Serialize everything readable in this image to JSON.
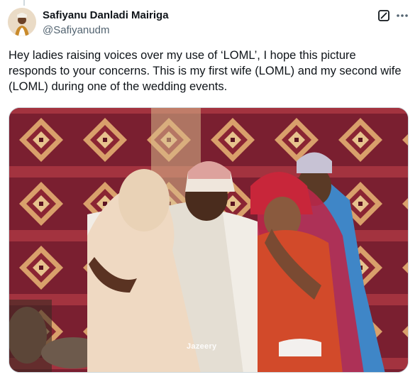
{
  "author": {
    "name": "Safiyanu Danladi Mairiga",
    "handle": "@Safiyanudm",
    "avatar_icon": "profile-photo"
  },
  "actions": {
    "grok_icon": "grok-icon",
    "more_icon": "more-icon"
  },
  "tweet": {
    "text": "Hey ladies raising voices over my use of ‘LOML’, I hope this picture responds to your concerns. This is my first wife (LOML) and my second wife (LOML) during one of the wedding events."
  },
  "media": {
    "watermark": "Jazeery",
    "description_icon": "wedding-photo"
  },
  "colors": {
    "text": "#0f1419",
    "secondary": "#536471",
    "border": "#cfd9de"
  }
}
